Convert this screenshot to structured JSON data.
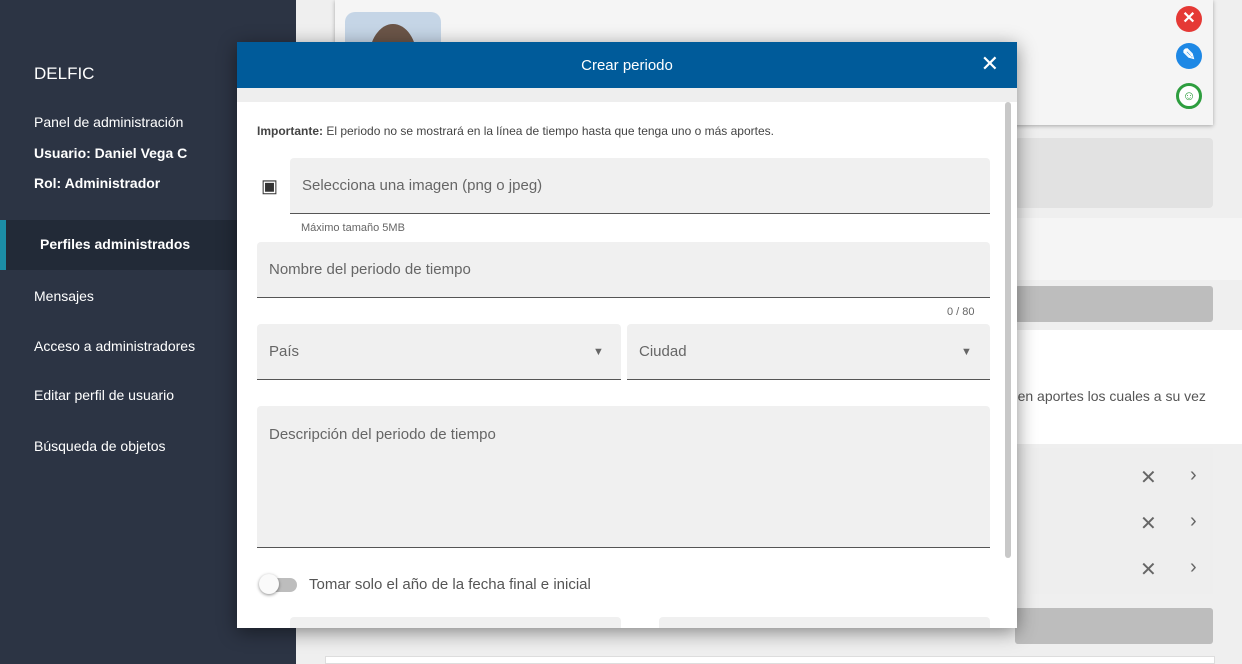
{
  "sidebar": {
    "brand": "DELFIC",
    "panel_title": "Panel de administración",
    "user": "Usuario: Daniel Vega C",
    "role": "Rol: Administrador",
    "active_item": "Perfiles administrados",
    "items": [
      "Mensajes",
      "Acceso a administradores",
      "Editar perfil de usuario",
      "Búsqueda de objetos"
    ]
  },
  "background": {
    "paragraph_fragment": "enen aportes los cuales a su vez",
    "icons": [
      "close-circle-icon",
      "edit-pencil-icon",
      "account-circle-icon"
    ],
    "list_rows": 3
  },
  "modal": {
    "title": "Crear periodo",
    "notice_bold": "Importante:",
    "notice_text": " El periodo no se mostrará en la línea de tiempo hasta que tenga uno o más aportes.",
    "image_field": {
      "placeholder": "Selecciona una imagen (png o jpeg)",
      "hint": "Máximo tamaño 5MB"
    },
    "name_field": {
      "placeholder": "Nombre del periodo de tiempo",
      "counter": "0 / 80"
    },
    "country_select": {
      "placeholder": "País"
    },
    "city_select": {
      "placeholder": "Ciudad"
    },
    "description_field": {
      "placeholder": "Descripción del periodo de tiempo"
    },
    "toggle": {
      "label": "Tomar solo el año de la fecha final e inicial",
      "checked": false
    }
  },
  "colors": {
    "sidebar_bg": "#2c3444",
    "sidebar_accent": "#1c8ea6",
    "modal_header": "#005b9a",
    "danger": "#e53935",
    "edit": "#1e88e5",
    "success": "#2e9e3f"
  }
}
